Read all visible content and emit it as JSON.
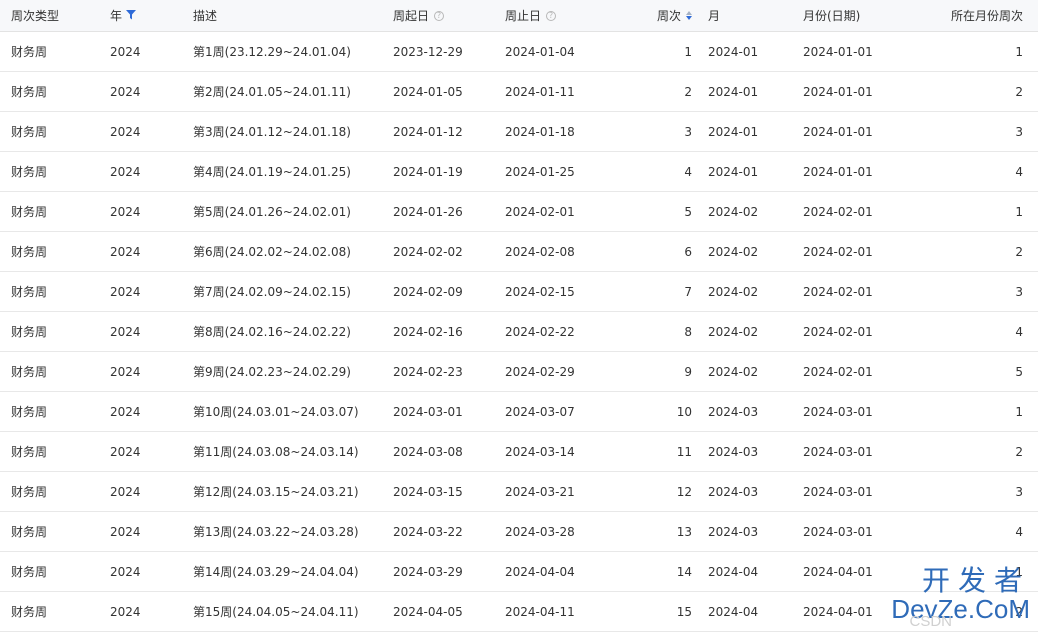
{
  "columns": {
    "type": "周次类型",
    "year": "年",
    "desc": "描述",
    "start": "周起日",
    "end": "周止日",
    "week": "周次",
    "month": "月",
    "month_date": "月份(日期)",
    "week_in_month": "所在月份周次"
  },
  "icons": {
    "year_filter": "filter-icon",
    "start_help": "question-circle-icon",
    "end_help": "question-circle-icon",
    "week_sort": "sort-icon"
  },
  "colors": {
    "accent": "#2f6bd8",
    "header_bg": "#f7f8fa",
    "row_border": "#e8e8e8",
    "text": "#333333"
  },
  "rows": [
    {
      "type": "财务周",
      "year": "2024",
      "desc": "第1周(23.12.29~24.01.04)",
      "start": "2023-12-29",
      "end": "2024-01-04",
      "week": "1",
      "month": "2024-01",
      "month_date": "2024-01-01",
      "week_in_month": "1"
    },
    {
      "type": "财务周",
      "year": "2024",
      "desc": "第2周(24.01.05~24.01.11)",
      "start": "2024-01-05",
      "end": "2024-01-11",
      "week": "2",
      "month": "2024-01",
      "month_date": "2024-01-01",
      "week_in_month": "2"
    },
    {
      "type": "财务周",
      "year": "2024",
      "desc": "第3周(24.01.12~24.01.18)",
      "start": "2024-01-12",
      "end": "2024-01-18",
      "week": "3",
      "month": "2024-01",
      "month_date": "2024-01-01",
      "week_in_month": "3"
    },
    {
      "type": "财务周",
      "year": "2024",
      "desc": "第4周(24.01.19~24.01.25)",
      "start": "2024-01-19",
      "end": "2024-01-25",
      "week": "4",
      "month": "2024-01",
      "month_date": "2024-01-01",
      "week_in_month": "4"
    },
    {
      "type": "财务周",
      "year": "2024",
      "desc": "第5周(24.01.26~24.02.01)",
      "start": "2024-01-26",
      "end": "2024-02-01",
      "week": "5",
      "month": "2024-02",
      "month_date": "2024-02-01",
      "week_in_month": "1"
    },
    {
      "type": "财务周",
      "year": "2024",
      "desc": "第6周(24.02.02~24.02.08)",
      "start": "2024-02-02",
      "end": "2024-02-08",
      "week": "6",
      "month": "2024-02",
      "month_date": "2024-02-01",
      "week_in_month": "2"
    },
    {
      "type": "财务周",
      "year": "2024",
      "desc": "第7周(24.02.09~24.02.15)",
      "start": "2024-02-09",
      "end": "2024-02-15",
      "week": "7",
      "month": "2024-02",
      "month_date": "2024-02-01",
      "week_in_month": "3"
    },
    {
      "type": "财务周",
      "year": "2024",
      "desc": "第8周(24.02.16~24.02.22)",
      "start": "2024-02-16",
      "end": "2024-02-22",
      "week": "8",
      "month": "2024-02",
      "month_date": "2024-02-01",
      "week_in_month": "4"
    },
    {
      "type": "财务周",
      "year": "2024",
      "desc": "第9周(24.02.23~24.02.29)",
      "start": "2024-02-23",
      "end": "2024-02-29",
      "week": "9",
      "month": "2024-02",
      "month_date": "2024-02-01",
      "week_in_month": "5"
    },
    {
      "type": "财务周",
      "year": "2024",
      "desc": "第10周(24.03.01~24.03.07)",
      "start": "2024-03-01",
      "end": "2024-03-07",
      "week": "10",
      "month": "2024-03",
      "month_date": "2024-03-01",
      "week_in_month": "1"
    },
    {
      "type": "财务周",
      "year": "2024",
      "desc": "第11周(24.03.08~24.03.14)",
      "start": "2024-03-08",
      "end": "2024-03-14",
      "week": "11",
      "month": "2024-03",
      "month_date": "2024-03-01",
      "week_in_month": "2"
    },
    {
      "type": "财务周",
      "year": "2024",
      "desc": "第12周(24.03.15~24.03.21)",
      "start": "2024-03-15",
      "end": "2024-03-21",
      "week": "12",
      "month": "2024-03",
      "month_date": "2024-03-01",
      "week_in_month": "3"
    },
    {
      "type": "财务周",
      "year": "2024",
      "desc": "第13周(24.03.22~24.03.28)",
      "start": "2024-03-22",
      "end": "2024-03-28",
      "week": "13",
      "month": "2024-03",
      "month_date": "2024-03-01",
      "week_in_month": "4"
    },
    {
      "type": "财务周",
      "year": "2024",
      "desc": "第14周(24.03.29~24.04.04)",
      "start": "2024-03-29",
      "end": "2024-04-04",
      "week": "14",
      "month": "2024-04",
      "month_date": "2024-04-01",
      "week_in_month": "1"
    },
    {
      "type": "财务周",
      "year": "2024",
      "desc": "第15周(24.04.05~24.04.11)",
      "start": "2024-04-05",
      "end": "2024-04-11",
      "week": "15",
      "month": "2024-04",
      "month_date": "2024-04-01",
      "week_in_month": "2"
    }
  ],
  "watermark": {
    "top": "开发者",
    "bottom": "DevZe.CoM",
    "faint": "CSDN"
  }
}
